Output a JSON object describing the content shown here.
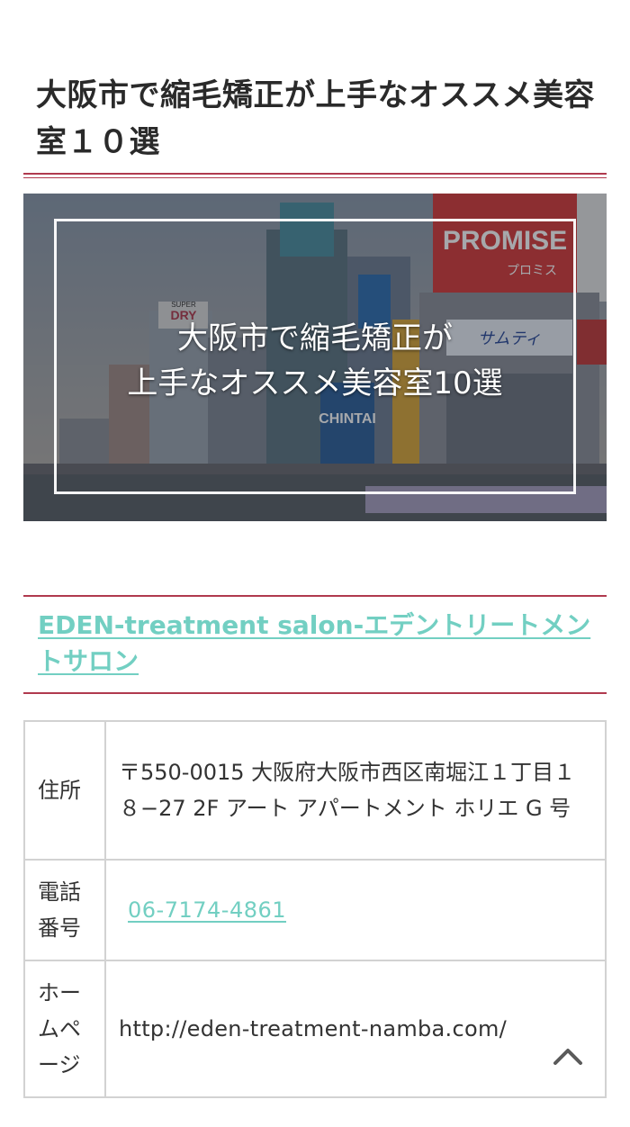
{
  "article": {
    "title": "大阪市で縮毛矯正が上手なオススメ美容室１０選"
  },
  "hero": {
    "line1": "大阪市で縮毛矯正が",
    "line2": "上手なオススメ美容室10選",
    "signs": {
      "promise": "PROMISE",
      "promise_kana": "プロミス",
      "dry": "DRY",
      "chintai": "CHINTAI",
      "sarmtein": "サムティ",
      "super": "SUPER"
    }
  },
  "salon": {
    "name": "EDEN-treatment salon-エデントリートメントサロン"
  },
  "info": {
    "address_label": "住所",
    "address_value": "〒550-0015 大阪府大阪市西区南堀江１丁目１８−27 2F アート アパートメント ホリエ G 号",
    "phone_label": "電話番号",
    "phone_value": "06-7174-4861",
    "homepage_label": "ホームページ",
    "homepage_value": "http://eden-treatment-namba.com/"
  },
  "colors": {
    "accent_rule": "#b03a4e",
    "link": "#72cfc2",
    "table_border": "#d2d2d2"
  },
  "icons": {
    "back_to_top": "chevron-up-icon"
  }
}
